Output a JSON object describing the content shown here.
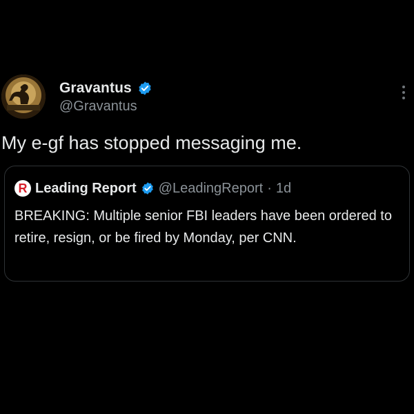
{
  "author": {
    "display_name": "Gravantus",
    "handle": "@Gravantus",
    "avatar_icon": "avatar-image",
    "verified_icon": "verified-badge-icon"
  },
  "tweet": {
    "text": "My e-gf has stopped messaging me."
  },
  "menu": {
    "icon": "more-options-icon"
  },
  "quote": {
    "logo_letter": "R",
    "display_name": "Leading Report",
    "handle": "@LeadingReport",
    "separator": "·",
    "time": "1d",
    "text": "BREAKING: Multiple senior FBI leaders have been ordered to retire, resign, or be fired by Monday, per CNN."
  },
  "colors": {
    "background": "#000000",
    "primary_text": "#e7e9ea",
    "secondary_text": "#8b9298",
    "verified_blue": "#1d9bf0",
    "border": "#2f3336",
    "logo_red": "#d81e2a"
  }
}
